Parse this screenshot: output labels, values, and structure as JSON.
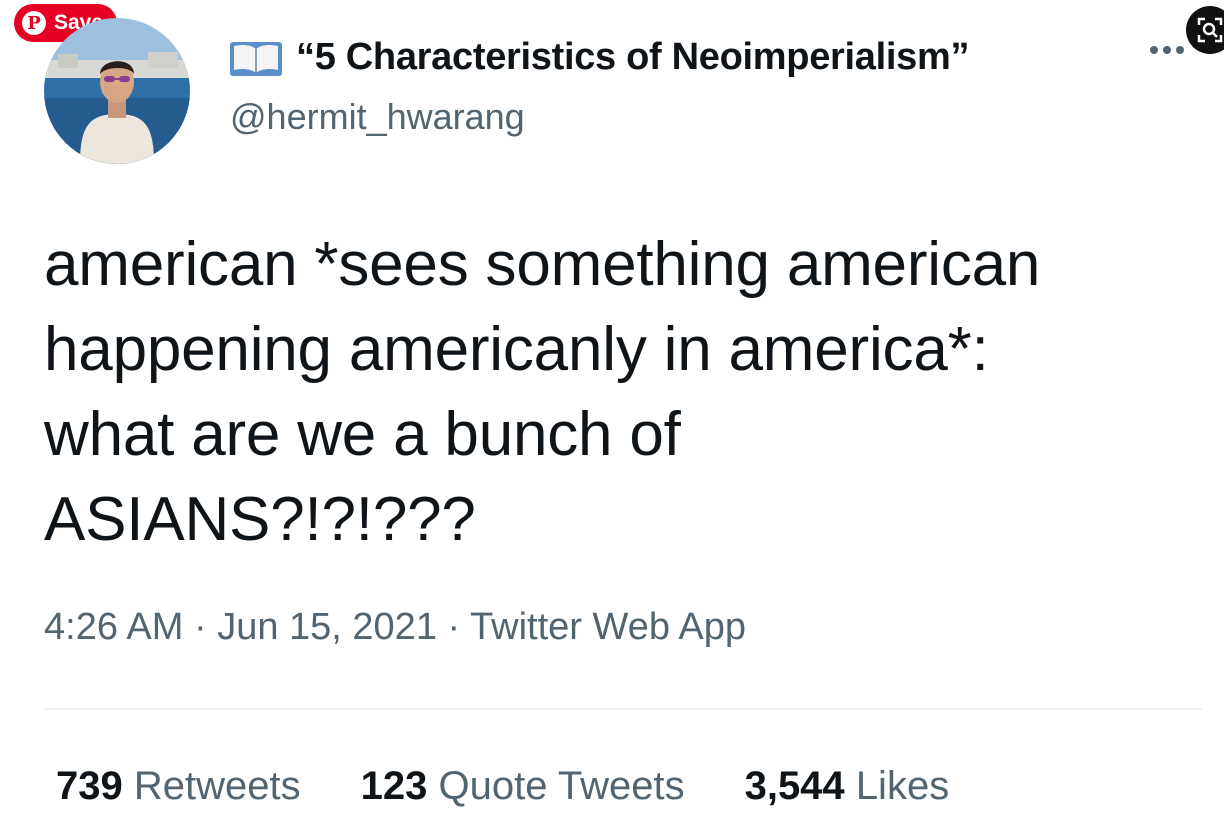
{
  "overlay": {
    "save_label": "Save",
    "pin_glyph": "P",
    "accent": "#e60023"
  },
  "tweet": {
    "display_name": "“5 Characteristics of Neoimperialism”",
    "handle": "@hermit_hwarang",
    "name_icon": "open-book-icon",
    "text_lines": [
      "american *sees something american",
      "happening americanly in america*:",
      "what are we a bunch of",
      "ASIANS?!?!???"
    ],
    "meta": {
      "time": "4:26 AM",
      "separator": " · ",
      "date": "Jun 15, 2021",
      "source": "Twitter Web App"
    },
    "stats": [
      {
        "count": "739",
        "label": "Retweets"
      },
      {
        "count": "123",
        "label": "Quote Tweets"
      },
      {
        "count": "3,544",
        "label": "Likes"
      }
    ]
  },
  "colors": {
    "text": "#0f1419",
    "muted": "#536471",
    "divider": "#eff3f4"
  }
}
